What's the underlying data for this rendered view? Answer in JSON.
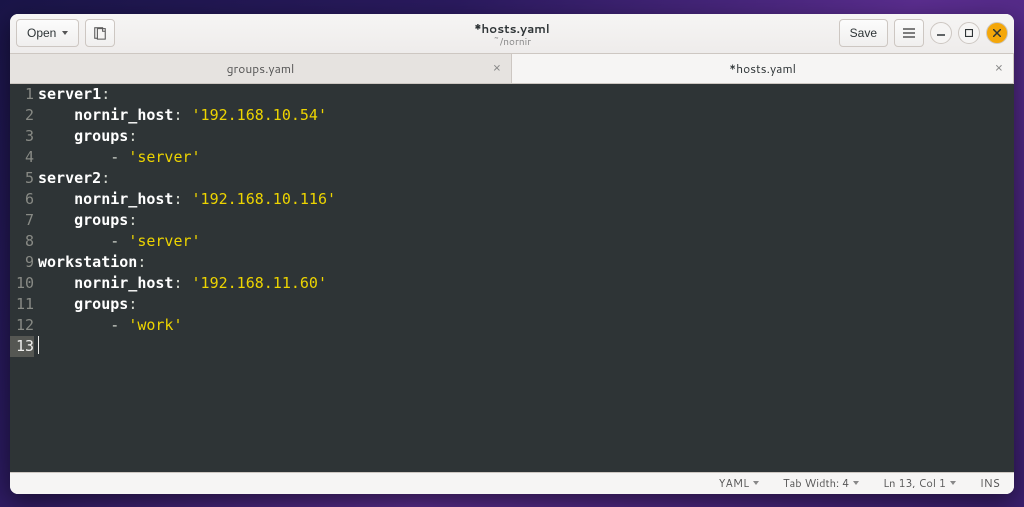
{
  "titlebar": {
    "open_label": "Open",
    "title": "*hosts.yaml",
    "subtitle": "~/nornir",
    "save_label": "Save"
  },
  "tabs": [
    {
      "label": "groups.yaml",
      "active": false
    },
    {
      "label": "*hosts.yaml",
      "active": true
    }
  ],
  "code": {
    "lines": [
      {
        "n": 1,
        "segs": [
          {
            "t": "key",
            "v": "server1"
          },
          {
            "t": "colon",
            "v": ":"
          }
        ]
      },
      {
        "n": 2,
        "segs": [
          {
            "t": "txt",
            "v": "    "
          },
          {
            "t": "key",
            "v": "nornir_host"
          },
          {
            "t": "colon",
            "v": ": "
          },
          {
            "t": "str",
            "v": "'192.168.10.54'"
          }
        ]
      },
      {
        "n": 3,
        "segs": [
          {
            "t": "txt",
            "v": "    "
          },
          {
            "t": "key",
            "v": "groups"
          },
          {
            "t": "colon",
            "v": ":"
          }
        ]
      },
      {
        "n": 4,
        "segs": [
          {
            "t": "txt",
            "v": "        - "
          },
          {
            "t": "str",
            "v": "'server'"
          }
        ]
      },
      {
        "n": 5,
        "segs": [
          {
            "t": "key",
            "v": "server2"
          },
          {
            "t": "colon",
            "v": ":"
          }
        ]
      },
      {
        "n": 6,
        "segs": [
          {
            "t": "txt",
            "v": "    "
          },
          {
            "t": "key",
            "v": "nornir_host"
          },
          {
            "t": "colon",
            "v": ": "
          },
          {
            "t": "str",
            "v": "'192.168.10.116'"
          }
        ]
      },
      {
        "n": 7,
        "segs": [
          {
            "t": "txt",
            "v": "    "
          },
          {
            "t": "key",
            "v": "groups"
          },
          {
            "t": "colon",
            "v": ":"
          }
        ]
      },
      {
        "n": 8,
        "segs": [
          {
            "t": "txt",
            "v": "        - "
          },
          {
            "t": "str",
            "v": "'server'"
          }
        ]
      },
      {
        "n": 9,
        "segs": [
          {
            "t": "key",
            "v": "workstation"
          },
          {
            "t": "colon",
            "v": ":"
          }
        ]
      },
      {
        "n": 10,
        "segs": [
          {
            "t": "txt",
            "v": "    "
          },
          {
            "t": "key",
            "v": "nornir_host"
          },
          {
            "t": "colon",
            "v": ": "
          },
          {
            "t": "str",
            "v": "'192.168.11.60'"
          }
        ]
      },
      {
        "n": 11,
        "segs": [
          {
            "t": "txt",
            "v": "    "
          },
          {
            "t": "key",
            "v": "groups"
          },
          {
            "t": "colon",
            "v": ":"
          }
        ]
      },
      {
        "n": 12,
        "segs": [
          {
            "t": "txt",
            "v": "        - "
          },
          {
            "t": "str",
            "v": "'work'"
          }
        ]
      },
      {
        "n": 13,
        "segs": [],
        "current": true
      }
    ]
  },
  "status": {
    "lang": "YAML",
    "tabwidth": "Tab Width: 4",
    "position": "Ln 13, Col 1",
    "mode": "INS"
  }
}
